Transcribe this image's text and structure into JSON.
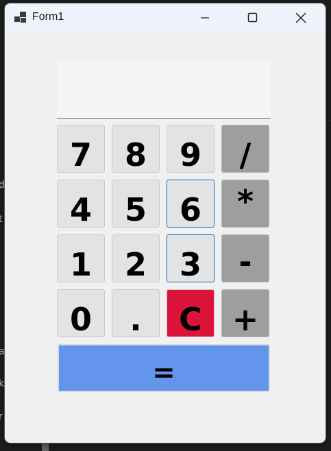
{
  "window": {
    "title": "Form1"
  },
  "background": {
    "fragments": [
      "d",
      "t",
      "a",
      "k",
      "r"
    ]
  },
  "display": {
    "value": ""
  },
  "keypad": {
    "row1": [
      "7",
      "8",
      "9",
      "/"
    ],
    "row2": [
      "4",
      "5",
      "6",
      "*"
    ],
    "row3": [
      "1",
      "2",
      "3",
      "-"
    ],
    "row4": [
      "0",
      ".",
      "C",
      "+"
    ],
    "equals": "="
  },
  "colors": {
    "operator": "#9e9e9e",
    "clear": "#dc143c",
    "equals": "#6495ed",
    "number": "#e3e3e3"
  },
  "icons": {
    "app": "windows-form-icon",
    "minimize": "minimize-icon",
    "maximize": "maximize-icon",
    "close": "close-icon"
  }
}
